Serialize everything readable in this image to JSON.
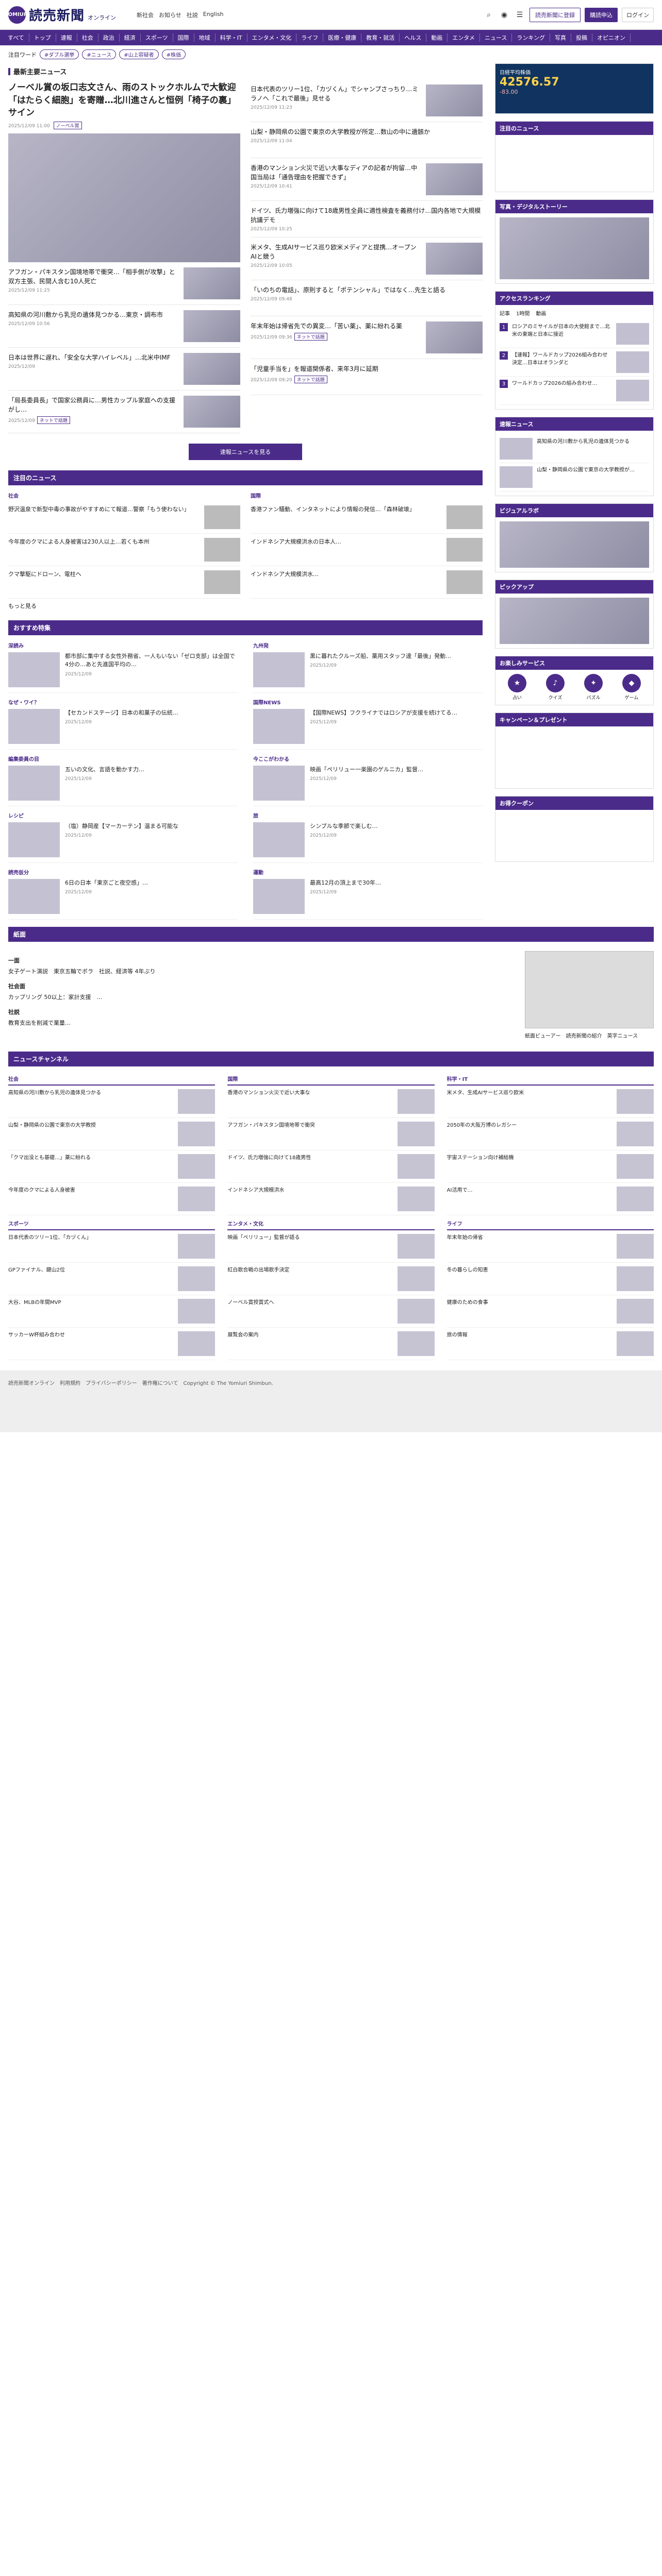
{
  "header": {
    "logo_mark": "YOMIURI",
    "logo_title": "読売新聞",
    "logo_sub": "オンライン",
    "top_links": [
      "新社会",
      "お知らせ",
      "社説",
      "English"
    ],
    "btn_register": "読売新聞に登録",
    "btn_subscribe": "購読申込",
    "btn_login": "ログイン"
  },
  "nav": [
    "すべて",
    "トップ",
    "速報",
    "社会",
    "政治",
    "経済",
    "スポーツ",
    "国際",
    "地域",
    "科学・IT",
    "エンタメ・文化",
    "ライフ",
    "医療・健康",
    "教育・就活",
    "ヘルス",
    "動画",
    "エンタメ",
    "ニュース",
    "ランキング",
    "写真",
    "投稿",
    "オピニオン"
  ],
  "trends": {
    "label": "注目ワード",
    "tags": [
      "#ダブル選挙",
      "#ニュース",
      "#山上容疑者",
      "#株価"
    ]
  },
  "top_news": {
    "section_title": "最新主要ニュース",
    "lead": {
      "title": "ノーベル賞の坂口志文さん、雨のストックホルムで大歓迎「はたらく細胞」を寄贈…北川進さんと恒例「椅子の裏」サイン",
      "meta": "2025/12/09 11:00",
      "badge": "ノーベル賞"
    },
    "left": [
      {
        "title": "アフガン・パキスタン国境地帯で衝突…「相手側が攻撃」と双方主張、民間人含む10人死亡",
        "meta": "2025/12/09 11:25"
      },
      {
        "title": "高知県の河川敷から乳児の遺体見つかる…東京・調布市",
        "meta": "2025/12/09 10:56"
      },
      {
        "title": "日本は世界に遅れ、「安全な大学ハイレベル」…北米中IMF",
        "meta": "2025/12/09"
      },
      {
        "title": "「局長委員長」で国家公務員に…男性カップル家庭への支援がし…",
        "meta": "2025/12/09",
        "badge": "ネットで話題"
      }
    ],
    "right": [
      {
        "title": "日本代表のツリー1位、「カヅくん」でシャンプさっちり…ミラノへ「これで最後」見せる",
        "meta": "2025/12/09 11:23"
      },
      {
        "title": "山梨・静岡県の公園で東京の大学教授が所定…数山の中に遺骸か",
        "meta": "2025/12/09 11:04"
      },
      {
        "title": "香港のマンション火災で近い大事なディアの記者が拘留…中国当局は「通告理由を把握できず」",
        "meta": "2025/12/09 10:41"
      },
      {
        "title": "ドイツ、氏力増強に向けて18歳男性全員に適性検査を義務付け…国内各地で大規模抗議デモ",
        "meta": "2025/12/09 10:25"
      },
      {
        "title": "米メタ、生成AIサービス巡り欧米メディアと提携…オープンAIと競う",
        "meta": "2025/12/09 10:05"
      },
      {
        "title": "「いのちの電話」、原則すると「ポテンシャル」ではなく…先生と語る",
        "meta": "2025/12/09 09:48"
      },
      {
        "title": "年末年始は帰省先での異変…「苦い薬」、薬に紛れる薬",
        "meta": "2025/12/09 09:36",
        "badge": "ネットで話題"
      },
      {
        "title": "「児童手当を」を報道関係者、来年3月に延期",
        "meta": "2025/12/09 09:20",
        "badge": "ネットで話題"
      }
    ],
    "more": "速報ニュースを見る"
  },
  "notable": {
    "band": "注目のニュース",
    "cols": [
      {
        "label": "社会",
        "items": [
          {
            "title": "野沢温泉で新型中毒の事故がやすすめにて報道…警察「もう使わない」",
            "meta": "2025/12/09"
          },
          {
            "title": "今年度のクマによる人身被害は230人以上…若くも本州",
            "meta": "2025/12/09"
          },
          {
            "title": "クマ撃駆にドローン、電柱へ",
            "meta": "2025/12/09"
          }
        ]
      },
      {
        "label": "国際",
        "items": [
          {
            "title": "香港ファン騒動、インタネットにより情報の発信…「森林破壊」",
            "meta": "2025/12/09"
          },
          {
            "title": "インドネシア大規模洪水の日本人…",
            "meta": "2025/12/09"
          },
          {
            "title": "インドネシア大規模洪水…",
            "meta": "2025/12/09"
          }
        ]
      }
    ],
    "more": "もっと見る"
  },
  "features": {
    "band": "おすすめ特集",
    "boxes": [
      {
        "label": "深読み",
        "title": "都市部に集中する女性外務省、一人もいない「ゼロ支部」は全国で4分の…あと先進国平均の…",
        "meta": "2025/12/09"
      },
      {
        "label": "九州発",
        "title": "黒に暮れたクルーズ船、薬用スタッフ達「最後」発動…",
        "meta": "2025/12/09"
      },
      {
        "label": "なぜ・ワイ？",
        "title": "【セカンドステージ】日本の和菓子の伝統…",
        "meta": "2025/12/09"
      },
      {
        "label": "国際NEWS",
        "title": "【国際NEWS】フクライナではロシアが支援を続けてる…",
        "meta": "2025/12/09"
      },
      {
        "label": "編集委員の目",
        "title": "五いの文化、言語を動かす力…",
        "meta": "2025/12/09"
      },
      {
        "label": "今ここがわかる",
        "title": "映画「ペリリュー一楽園のゲルニカ」監督…",
        "meta": "2025/12/09"
      },
      {
        "label": "レシピ",
        "title": "（塩）静岡産【マーカーテン】温まる可能な",
        "meta": "2025/12/09"
      },
      {
        "label": "旅",
        "title": "シンプルな季節で楽しむ…",
        "meta": "2025/12/09"
      },
      {
        "label": "読売仮分",
        "title": "6日の日本「東京ごと夜空感」…",
        "meta": "2025/12/09"
      },
      {
        "label": "運動",
        "title": "最高12月の頂上まで30年…",
        "meta": "2025/12/09"
      }
    ]
  },
  "side": {
    "market_title": "日経平均株価",
    "market_value": "42576.57",
    "market_change": "-83.00",
    "attention_head": "注目のニュース",
    "photo_head": "写真・デジタルストーリー",
    "rank_head": "アクセスランキング",
    "rank_tabs": [
      "記事",
      "1時間",
      "動画"
    ],
    "ranking": [
      {
        "no": "1",
        "title": "ロシアのミサイルが日本の大使館まで…北米の東端と日本に接近"
      },
      {
        "no": "2",
        "title": "【速報】ワールドカップ2026組み合わせ決定…日本はオランダと"
      },
      {
        "no": "3",
        "title": "ワールドカップ2026の組み合わせ…"
      }
    ],
    "report_head": "速報ニュース",
    "reports": [
      {
        "title": "高知県の河川敷から乳児の遺体見つかる"
      },
      {
        "title": "山梨・静岡県の公園で東京の大学教授が…"
      }
    ],
    "visual_head": "ビジュアルラボ",
    "pickup_head": "ピックアップ",
    "services_head": "お楽しみサービス",
    "services": [
      {
        "icon": "★",
        "label": "占い"
      },
      {
        "icon": "♪",
        "label": "クイズ"
      },
      {
        "icon": "✦",
        "label": "パズル"
      },
      {
        "icon": "◆",
        "label": "ゲーム"
      }
    ],
    "campaign_head": "キャンペーン＆プレゼント",
    "shopping_head": "お得クーポン"
  },
  "paper": {
    "band": "紙面",
    "heads": [
      "一面",
      "社会面",
      "社説"
    ],
    "lines": [
      "女子ゲート演説　東京五輪でボラ　社説、経済等 4年ぶり",
      "カップリング 50以上：家計支援　…",
      "教育支出を削減で業量…"
    ],
    "links": [
      "紙面ビューアー",
      "読売新聞の紹介",
      "英字ニュース"
    ]
  },
  "channels": {
    "band": "ニュースチャンネル",
    "cols": [
      {
        "label": "社会",
        "items": [
          "高知県の河川敷から乳児の遺体見つかる",
          "山梨・静岡県の公園で東京の大学教授",
          "「クマ出没とも基礎…」薬に紛れる",
          "今年度のクマによる人身被害"
        ]
      },
      {
        "label": "国際",
        "items": [
          "香港のマンション火災で近い大事な",
          "アフガン・パキスタン国境地帯で衝突",
          "ドイツ、氏力増強に向けて18歳男性",
          "インドネシア大規模洪水"
        ]
      },
      {
        "label": "科学・IT",
        "items": [
          "米メタ、生成AIサービス巡り欧米",
          "2050年の大阪万博のレガシー",
          "宇宙ステーション向け補給機",
          "AI活用で…"
        ]
      },
      {
        "label": "スポーツ",
        "items": [
          "日本代表のツリー1位、「カヅくん」",
          "GPファイナル、鍵山2位",
          "大谷、MLBの年間MVP",
          "サッカーW杯組み合わせ"
        ]
      },
      {
        "label": "エンタメ・文化",
        "items": [
          "映画「ペリリュー」監督が語る",
          "紅白歌合戦の出場歌手決定",
          "ノーベル賞授賞式へ",
          "展覧会の案内"
        ]
      },
      {
        "label": "ライフ",
        "items": [
          "年末年始の帰省",
          "冬の暮らしの知恵",
          "健康のための食事",
          "旅の情報"
        ]
      }
    ]
  },
  "footer": {
    "text": "読売新聞オンライン　利用規約　プライバシーポリシー　著作権について　Copyright © The Yomiuri Shimbun."
  }
}
